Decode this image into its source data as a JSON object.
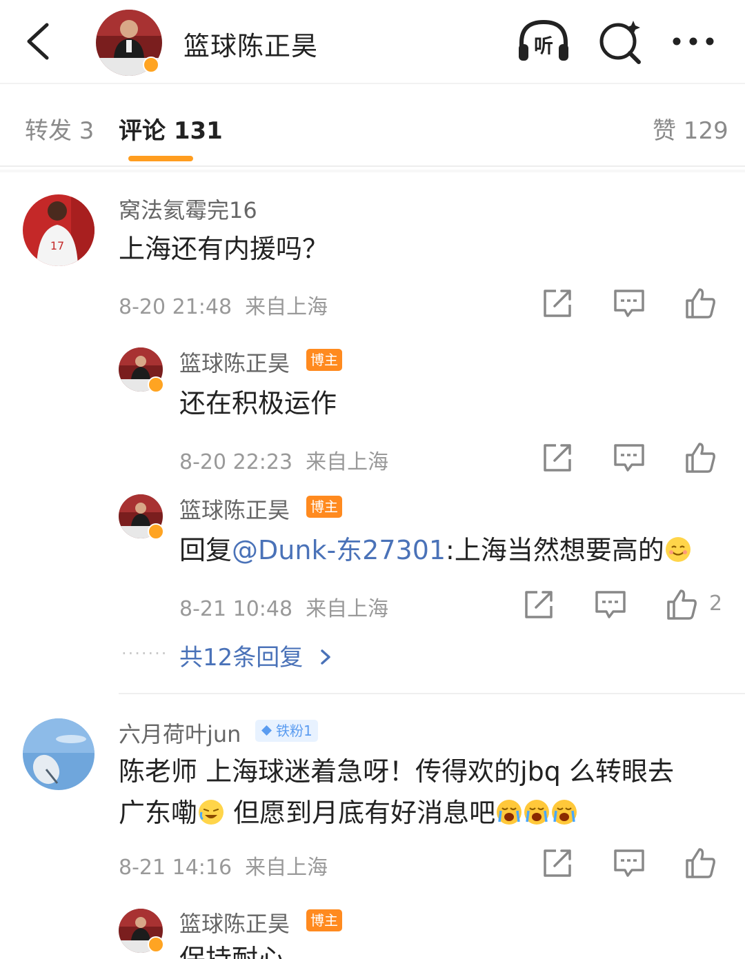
{
  "header": {
    "title": "篮球陈正昊",
    "listen_label": "听"
  },
  "tabs": {
    "repost": "转发 3",
    "comments": "评论 131",
    "likes": "赞 129"
  },
  "comments": [
    {
      "user": "窝法氦霉完16",
      "text": "上海还有内援吗？",
      "time": "8-20 21:48",
      "location": "来自上海",
      "replies": [
        {
          "user": "篮球陈正昊",
          "badge": "博主",
          "text": "还在积极运作",
          "time": "8-20 22:23",
          "location": "来自上海"
        },
        {
          "user": "篮球陈正昊",
          "badge": "博主",
          "reply_prefix": "回复",
          "mention": "@Dunk-东27301",
          "text": ":上海当然想要高的",
          "time": "8-21 10:48",
          "location": "来自上海",
          "likes": "2"
        }
      ],
      "more_replies": "共12条回复"
    },
    {
      "user": "六月荷叶jun",
      "fan_badge": "铁粉1",
      "text_line1": "陈老师 上海球迷着急呀！传得欢的jbq 么转眼去",
      "text_line2_a": "广东嘞",
      "text_line2_b": " 但愿到月底有好消息吧",
      "time": "8-21 14:16",
      "location": "来自上海",
      "replies": [
        {
          "user": "篮球陈正昊",
          "badge": "博主",
          "text": "保持耐心"
        }
      ]
    }
  ]
}
